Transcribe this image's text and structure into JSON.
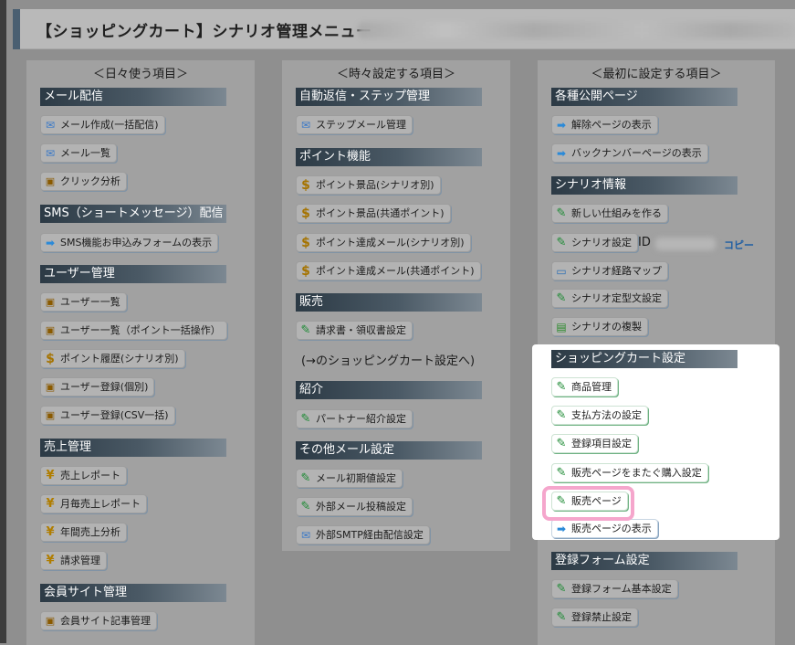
{
  "header": {
    "title": "【ショッピングカート】シナリオ管理メニュー"
  },
  "columns": [
    {
      "heading": "＜日々使う項目＞"
    },
    {
      "heading": "＜時々設定する項目＞"
    },
    {
      "heading": "＜最初に設定する項目＞"
    }
  ],
  "col1": {
    "sec_mail": "メール配信",
    "mail_create": "メール作成(一括配信)",
    "mail_list": "メール一覧",
    "click_analysis": "クリック分析",
    "sec_sms": "SMS（ショートメッセージ）配信",
    "sms_form": "SMS機能お申込みフォームの表示",
    "sec_user": "ユーザー管理",
    "user_list": "ユーザー一覧",
    "user_list_points": "ユーザー一覧（ポイント一括操作）",
    "point_history": "ポイント履歴(シナリオ別)",
    "user_register": "ユーザー登録(個別)",
    "user_register_csv": "ユーザー登録(CSV一括)",
    "sec_sales": "売上管理",
    "sales_report": "売上レポート",
    "monthly_report": "月毎売上レポート",
    "annual_analysis": "年間売上分析",
    "billing": "請求管理",
    "sec_member": "会員サイト管理",
    "member_articles": "会員サイト記事管理"
  },
  "col2": {
    "sec_auto": "自動返信・ステップ管理",
    "step_mail": "ステップメール管理",
    "sec_point": "ポイント機能",
    "point_prize_scenario": "ポイント景品(シナリオ別)",
    "point_prize_common": "ポイント景品(共通ポイント)",
    "point_mail_scenario": "ポイント達成メール(シナリオ別)",
    "point_mail_common": "ポイント達成メール(共通ポイント)",
    "sec_sell": "販売",
    "invoice_settings": "請求書・領収書設定",
    "cart_link_text": "(→のショッピングカート設定へ)",
    "sec_intro": "紹介",
    "partner_settings": "パートナー紹介設定",
    "sec_other": "その他メール設定",
    "mail_initial": "メール初期値設定",
    "external_post": "外部メール投稿設定",
    "external_smtp": "外部SMTP経由配信設定"
  },
  "col3": {
    "sec_public": "各種公開ページ",
    "unsubscribe_page": "解除ページの表示",
    "backnumber_page": "バックナンバーページの表示",
    "sec_scenario": "シナリオ情報",
    "new_scenario": "新しい仕組みを作る",
    "scenario_settings": "シナリオ設定",
    "id_label": "ID",
    "copy_label": "コピー",
    "route_map": "シナリオ経路マップ",
    "template_settings": "シナリオ定型文設定",
    "duplicate": "シナリオの複製",
    "sec_cart": "ショッピングカート設定",
    "products": "商品管理",
    "payment": "支払方法の設定",
    "fields": "登録項目設定",
    "cross_page": "販売ページをまたぐ購入設定",
    "sales_page": "販売ページ",
    "sales_page_show": "販売ページの表示",
    "sec_form": "登録フォーム設定",
    "form_basic": "登録フォーム基本設定",
    "register_block": "登録禁止設定"
  },
  "icons": [
    "envelope-icon",
    "user-card-icon",
    "dollar-icon",
    "yen-icon",
    "pencil-icon",
    "arrow-icon",
    "monitor-icon",
    "document-icon"
  ],
  "colors": {
    "section_bar": "#2c3a45",
    "highlight": "#f5a6cc",
    "spotlight": "#ffffff"
  }
}
